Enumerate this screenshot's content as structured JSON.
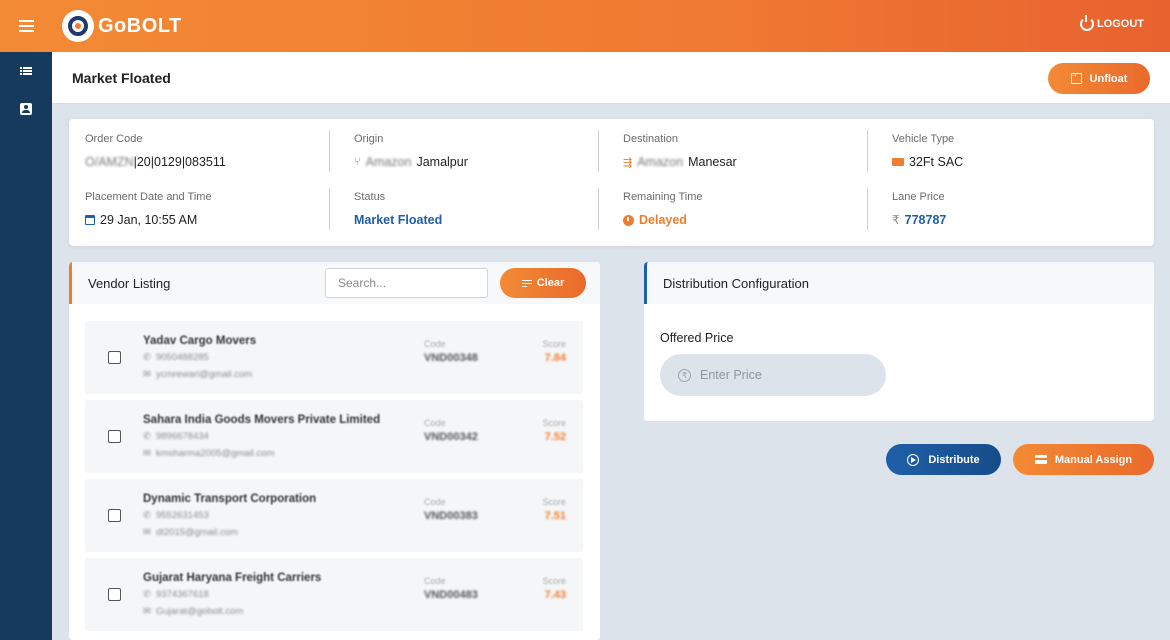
{
  "app": {
    "brand": "GoBOLT",
    "logout_label": "LOGOUT"
  },
  "header": {
    "title": "Market Floated",
    "unfloat_label": "Unfloat"
  },
  "order": {
    "order_code": {
      "label": "Order Code",
      "prefix": "O/AMZN",
      "value": "|20|0129|083511"
    },
    "origin": {
      "label": "Origin",
      "prefix": "Amazon",
      "value": "Jamalpur"
    },
    "destination": {
      "label": "Destination",
      "prefix": "Amazon",
      "value": "Manesar"
    },
    "vehicle_type": {
      "label": "Vehicle Type",
      "value": "32Ft SAC"
    },
    "placement": {
      "label": "Placement Date and Time",
      "value": "29 Jan, 10:55 AM"
    },
    "status": {
      "label": "Status",
      "value": "Market Floated"
    },
    "remaining": {
      "label": "Remaining Time",
      "value": "Delayed"
    },
    "lane_price": {
      "label": "Lane Price",
      "currency": "₹",
      "value": "778787"
    }
  },
  "vendor_listing": {
    "title": "Vendor Listing",
    "search_placeholder": "Search...",
    "clear_label": "Clear",
    "code_label": "Code",
    "score_label": "Score",
    "vendors": [
      {
        "name": "Yadav Cargo Movers",
        "phone": "9050488285",
        "email": "ycmrewari@gmail.com",
        "code": "VND00348",
        "score": "7.84"
      },
      {
        "name": "Sahara India Goods Movers Private Limited",
        "phone": "9896678434",
        "email": "kmsharma2005@gmail.com",
        "code": "VND00342",
        "score": "7.52"
      },
      {
        "name": "Dynamic Transport Corporation",
        "phone": "9552631453",
        "email": "dt2015@gmail.com",
        "code": "VND00383",
        "score": "7.51"
      },
      {
        "name": "Gujarat Haryana Freight Carriers",
        "phone": "9374367618",
        "email": "Gujarat@gobolt.com",
        "code": "VND00483",
        "score": "7.43"
      }
    ]
  },
  "distribution": {
    "title": "Distribution Configuration",
    "offered_price_label": "Offered Price",
    "price_placeholder": "Enter Price",
    "distribute_label": "Distribute",
    "manual_assign_label": "Manual Assign"
  },
  "colors": {
    "orange": "#ef7d2e",
    "navy": "#153a5e",
    "blue": "#1f5fa8"
  }
}
